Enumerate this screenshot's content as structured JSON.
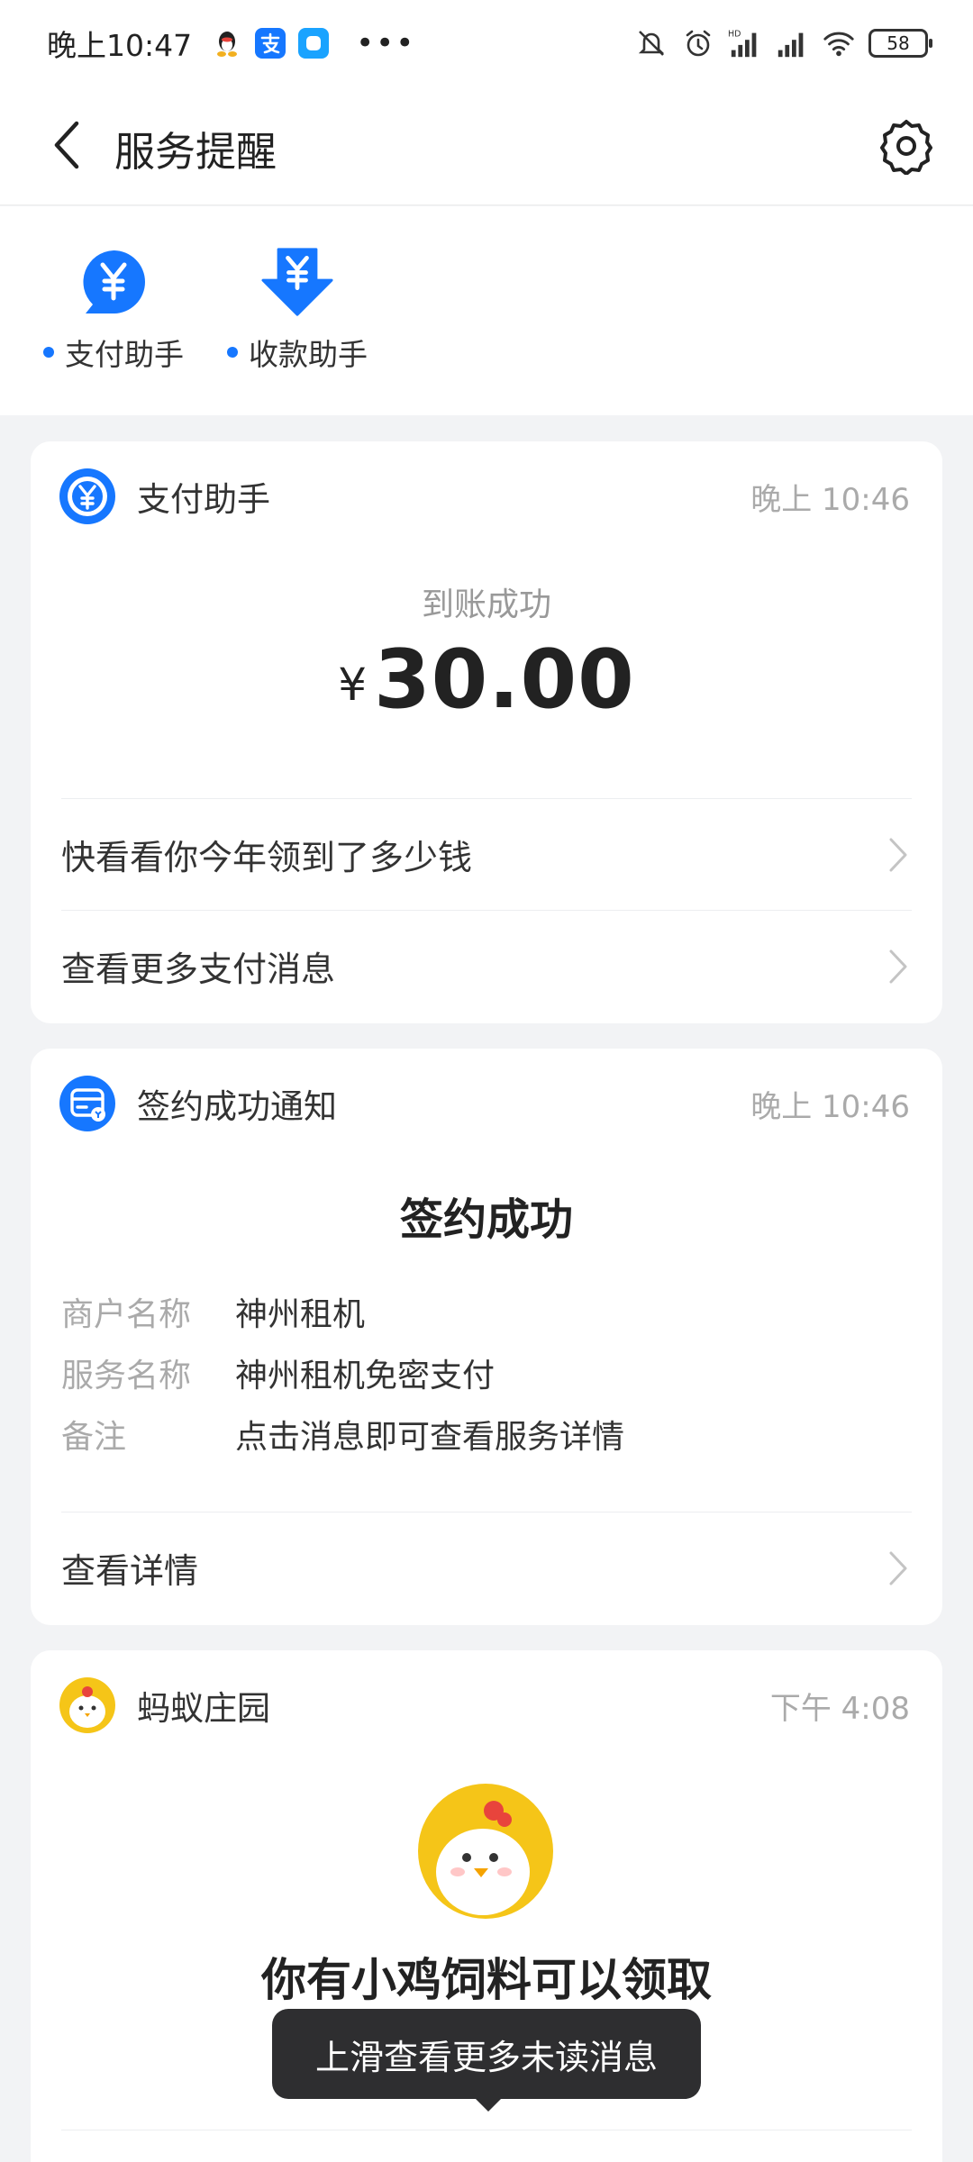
{
  "status_bar": {
    "time": "晚上10:47",
    "dots": "•••",
    "battery": "58"
  },
  "header": {
    "title": "服务提醒"
  },
  "shortcuts": [
    {
      "label": "支付助手",
      "icon": "yuan-bubble-icon"
    },
    {
      "label": "收款助手",
      "icon": "yuan-down-arrow-icon"
    }
  ],
  "cards": {
    "payment": {
      "name": "支付助手",
      "time": "晚上 10:46",
      "status": "到账成功",
      "currency": "¥",
      "amount": "30.00",
      "rows": [
        "快看看你今年领到了多少钱",
        "查看更多支付消息"
      ]
    },
    "contract": {
      "name": "签约成功通知",
      "time": "晚上 10:46",
      "title": "签约成功",
      "fields": [
        {
          "key": "商户名称",
          "value": "神州租机"
        },
        {
          "key": "服务名称",
          "value": "神州租机免密支付"
        },
        {
          "key": "备注",
          "value": "点击消息即可查看服务详情"
        }
      ],
      "row": "查看详情"
    },
    "farm": {
      "name": "蚂蚁庄园",
      "time": "下午 4:08",
      "title": "你有小鸡饲料可以领取"
    }
  },
  "toast": "上滑查看更多未读消息",
  "colors": {
    "accent": "#1677ff",
    "farm_yellow": "#f5c518"
  }
}
